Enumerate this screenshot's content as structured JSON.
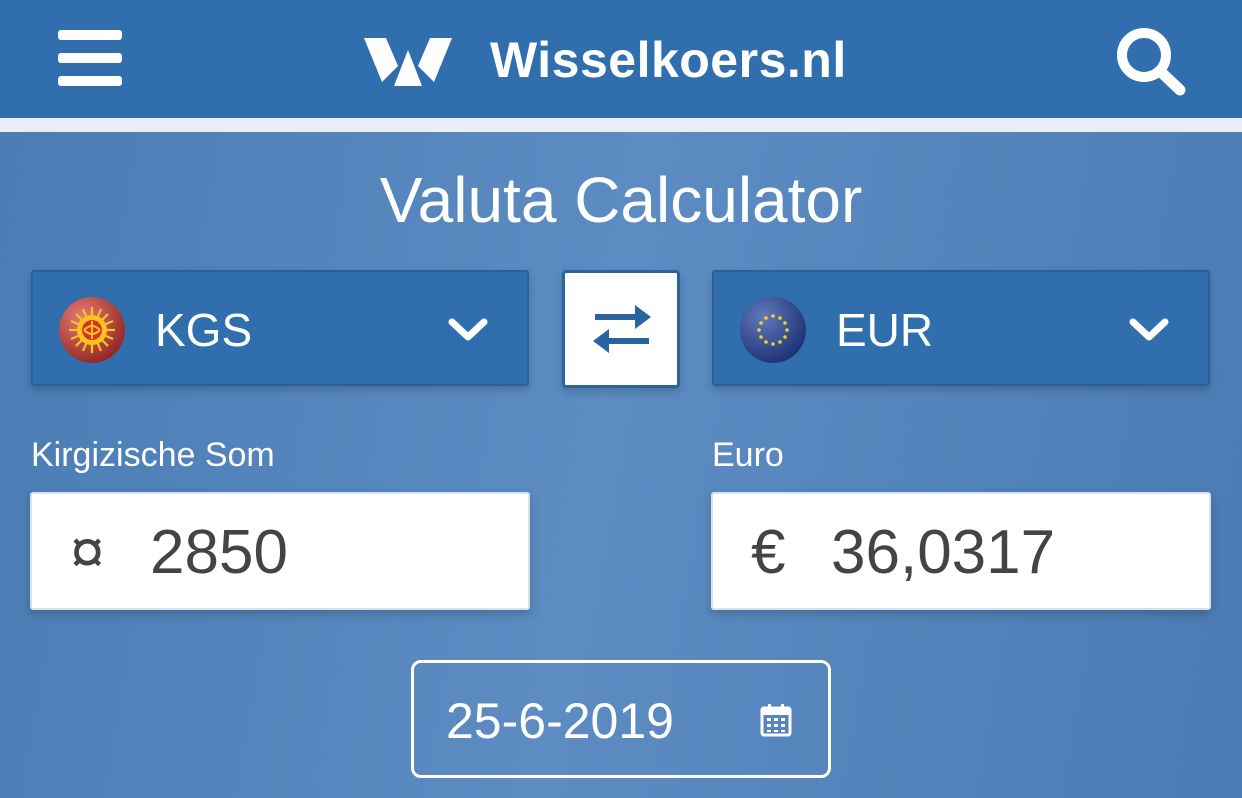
{
  "header": {
    "menu_icon": "hamburger-menu-icon",
    "logo_text": "Wisselkoers.nl",
    "search_icon": "search-icon"
  },
  "calculator": {
    "title": "Valuta Calculator",
    "from": {
      "code": "KGS",
      "flag": "kyrgyzstan-flag-icon",
      "label": "Kirgizische Som",
      "symbol": "¤",
      "amount": "2850"
    },
    "to": {
      "code": "EUR",
      "flag": "eu-flag-icon",
      "label": "Euro",
      "symbol": "€",
      "amount": "36,0317"
    },
    "swap_icon": "swap-arrows-icon",
    "date": "25-6-2019",
    "date_icon": "calendar-icon"
  },
  "colors": {
    "header_bg": "#306ead",
    "select_bg": "#306ead",
    "page_bg": "#4f7fb5",
    "text_dark": "#444444"
  }
}
